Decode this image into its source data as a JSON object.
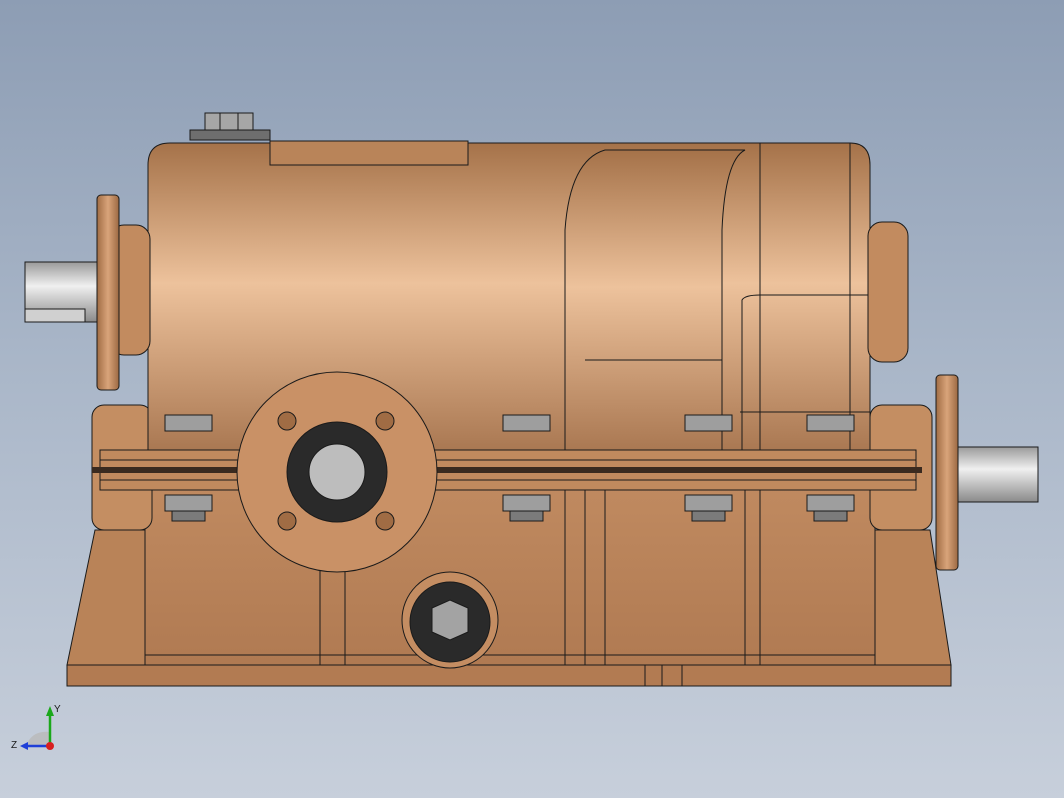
{
  "viewport": {
    "background_top": "#8d9db4",
    "background_bottom": "#c7cfdb"
  },
  "model": {
    "body_color": "#b57f55",
    "body_highlight": "#edc29c",
    "shaft_color": "#bcbcbc",
    "bolt_color": "#9a9a9a",
    "seal_color": "#2a2a2a",
    "edge_color": "#1a1a1a"
  },
  "triad": {
    "y_label": "Y",
    "z_label": "Z",
    "y_color": "#1aa81a",
    "z_color": "#1f3fd8",
    "origin_color": "#d81f1f"
  }
}
